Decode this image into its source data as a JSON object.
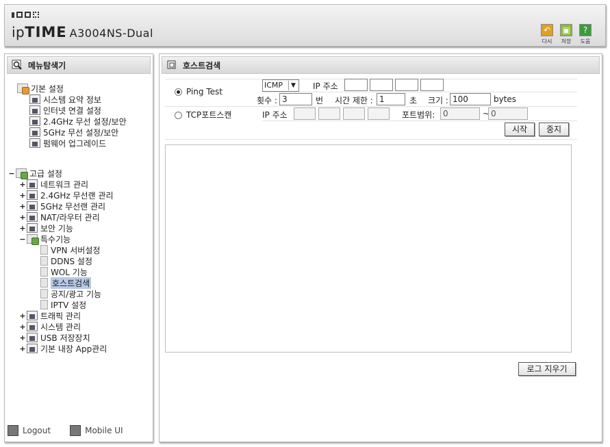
{
  "header": {
    "brand_pre": "ip",
    "brand_bold": "TIME",
    "model": "A3004NS-Dual",
    "tools": [
      {
        "icon": "undo-icon",
        "label": "다시"
      },
      {
        "icon": "save-icon",
        "label": "저장"
      },
      {
        "icon": "help-icon",
        "label": "도움"
      }
    ]
  },
  "sidebar": {
    "title": "메뉴탐색기",
    "basic": {
      "label": "기본 설정",
      "items": [
        "시스템 요약 정보",
        "인터넷 연결 설정",
        "2.4GHz 무선 설정/보안",
        "5GHz 무선 설정/보안",
        "펌웨어 업그레이드"
      ]
    },
    "advanced": {
      "toggle": "−",
      "label": "고급 설정",
      "items": [
        {
          "toggle": "+",
          "label": "네트워크 관리"
        },
        {
          "toggle": "+",
          "label": "2.4GHz 무선랜 관리"
        },
        {
          "toggle": "+",
          "label": "5GHz 무선랜 관리"
        },
        {
          "toggle": "+",
          "label": "NAT/라우터 관리"
        },
        {
          "toggle": "+",
          "label": "보안 기능"
        },
        {
          "toggle": "−",
          "label": "특수기능"
        },
        {
          "toggle": "+",
          "label": "트래픽 관리"
        },
        {
          "toggle": "+",
          "label": "시스템 관리"
        },
        {
          "toggle": "+",
          "label": "USB 저장장치"
        },
        {
          "toggle": "+",
          "label": "기본 내장 App관리"
        }
      ],
      "special_children": [
        "VPN 서버설정",
        "DDNS 설정",
        "WOL 기능",
        "호스트검색",
        "공지/광고 기능",
        "IPTV 설정"
      ],
      "selected": "호스트검색"
    },
    "footer": {
      "logout": "Logout",
      "mobile": "Mobile UI"
    }
  },
  "main": {
    "title": "호스트검색",
    "ping": {
      "label": "Ping Test",
      "protocol": "ICMP",
      "ip_label": "IP 주소",
      "count_label": "횟수 :",
      "count_value": "3",
      "count_unit": "번",
      "timeout_label": "시간 제한 :",
      "timeout_value": "1",
      "timeout_unit": "초",
      "size_label": "크기 :",
      "size_value": "100",
      "size_unit": "bytes"
    },
    "tcp": {
      "label": "TCP포트스캔",
      "ip_label": "IP 주소",
      "port_label": "포트범위:",
      "port_from": "0",
      "tilde": "~",
      "port_to": "0"
    },
    "start_button": "시작",
    "stop_button": "중지",
    "clear_log_button": "로그 지우기"
  }
}
